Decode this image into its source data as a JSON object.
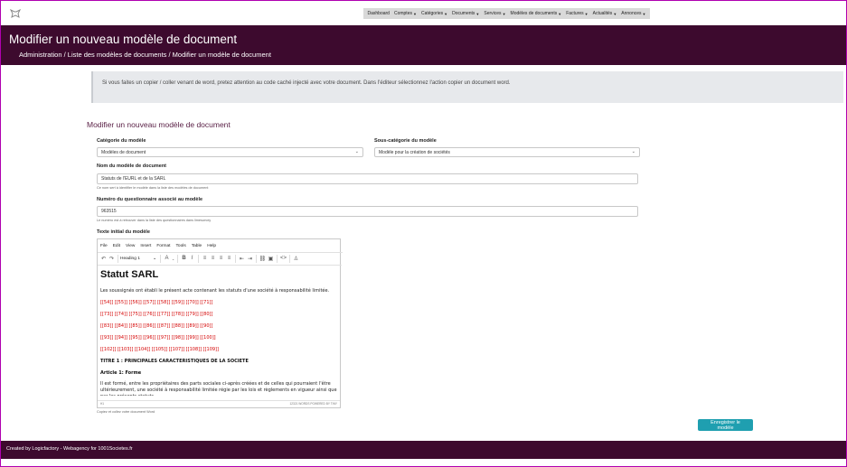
{
  "nav": {
    "items": [
      {
        "label": "Dashboard",
        "dropdown": false
      },
      {
        "label": "Comptes",
        "dropdown": true
      },
      {
        "label": "Catégories",
        "dropdown": true
      },
      {
        "label": "Documents",
        "dropdown": true
      },
      {
        "label": "Services",
        "dropdown": true
      },
      {
        "label": "Modèles de documents",
        "dropdown": true
      },
      {
        "label": "Factures",
        "dropdown": true
      },
      {
        "label": "Actualités",
        "dropdown": true
      },
      {
        "label": "Annonces",
        "dropdown": true
      }
    ]
  },
  "header": {
    "title": "Modifier un nouveau modèle de document",
    "breadcrumb": "Administration / Liste des modèles de documents / Modifier un modèle de document"
  },
  "notice": {
    "text": "Si vous faites un copier / coller venant de word, pretez attention au code caché injecté avec votre document. Dans l'éditeur sélectionnez l'action copier un document word."
  },
  "form": {
    "title": "Modifier un nouveau modèle de document",
    "category_label": "Catégorie du modèle",
    "category_value": "Modèles de document",
    "subcategory_label": "Sous-catégorie du modèle",
    "subcategory_value": "Modèle pour la création de sociétés",
    "name_label": "Nom du modèle de document",
    "name_value": "Statuts de l'EURL et de la SARL",
    "name_help": "Ce nom sert à identifier le modèle dans la liste des modèles de document",
    "survey_label": "Numéro du questionnaire associé au modèle",
    "survey_value": "963515",
    "survey_help": "Le numéro est à retrouver dans la liste des questionnaires dans limesurvey",
    "text_label": "Texte initial du modèle",
    "text_help": "Copiez et collez votre document Word",
    "save_label": "Enregistrer le modèle"
  },
  "editor": {
    "menu": [
      "File",
      "Edit",
      "View",
      "Insert",
      "Format",
      "Tools",
      "Table",
      "Help"
    ],
    "format_select": "Heading 1",
    "heading": "Statut SARL",
    "intro": "Les soussignés ont établi le présent acte contenant les statuts d'une société à responsabilité limitée.",
    "fields": [
      "[[54]] [[55]] [[56]] [[57]] [[58]] [[59]] [[70]] [[71]]",
      "[[73]] [[74]] [[75]] [[76]] [[77]] [[78]] [[79]] [[80]]",
      "[[83]] [[84]] [[85]] [[86]] [[87]] [[88]] [[89]] [[90]]",
      "[[93]] [[94]] [[95]] [[96]] [[97]] [[98]] [[99]] [[100]]",
      "[[102]] [[103]] [[104]] [[105]] [[107]] [[108]] [[109]]"
    ],
    "title1": "TITRE 1 : PRINCIPALES CARACTERISTIQUES DE LA SOCIETE",
    "article1": "Article 1: Forme",
    "article1_text": "Il est formé, entre les propriétaires des parts sociales ci-après créées et de celles qui pourraient l'être ultérieurement, une société à responsabilité limitée régie par les lois et règlements en vigueur ainsi que par les présents statuts.",
    "status_left": "H1",
    "status_right": "12321 WORDS  POWERED BY TINY"
  },
  "footer": {
    "text": "Created by Logicfactory - Webagency for 1001Societes.fr"
  },
  "colors": {
    "header_bg": "#3d0a2e",
    "accent_button": "#1f9fb0",
    "field_placeholder_red": "#d40000"
  }
}
